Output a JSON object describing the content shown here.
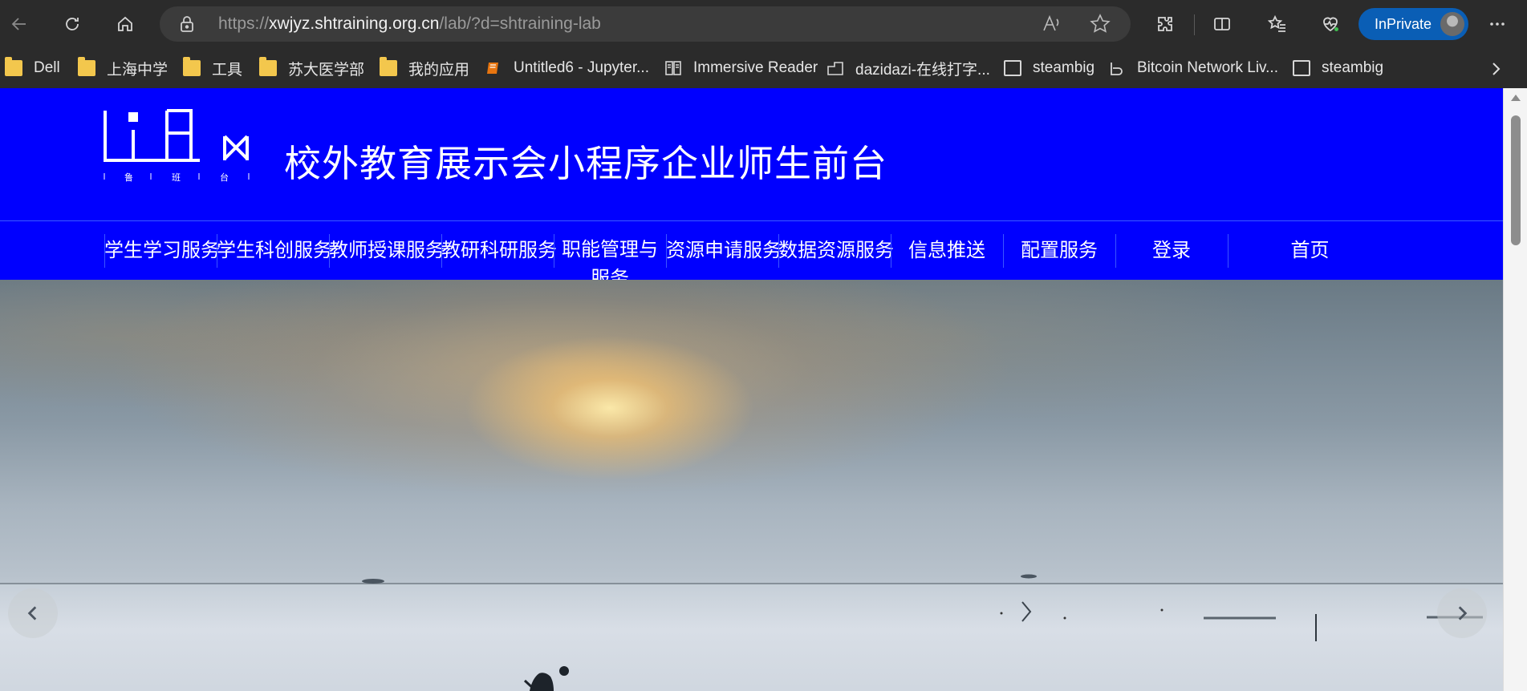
{
  "browser": {
    "url_prefix": "https://",
    "url_host": "xwjyz.shtraining.org.cn",
    "url_path": "/lab/?d=shtraining-lab",
    "inprivate_label": "InPrivate"
  },
  "bookmarks": [
    {
      "label": "Dell",
      "icon": "folder-icon"
    },
    {
      "label": "上海中学",
      "icon": "folder-icon"
    },
    {
      "label": "工具",
      "icon": "folder-icon"
    },
    {
      "label": "苏大医学部",
      "icon": "folder-icon"
    },
    {
      "label": "我的应用",
      "icon": "folder-icon"
    },
    {
      "label": "Untitled6 - Jupyter...",
      "icon": "jupyter-icon"
    },
    {
      "label": "Immersive Reader",
      "icon": "reader-icon"
    },
    {
      "label": "dazidazi-在线打字...",
      "icon": "typing-icon"
    },
    {
      "label": "steambig",
      "icon": "page-icon"
    },
    {
      "label": "Bitcoin Network Liv...",
      "icon": "bitcoin-icon"
    },
    {
      "label": "steambig",
      "icon": "page-icon"
    }
  ],
  "site": {
    "logo_chars": [
      "鲁",
      "班",
      "台"
    ],
    "title": "校外教育展示会小程序企业师生前台",
    "nav": [
      "学生学习服务",
      "学生科创服务",
      "教师授课服务",
      "教研科研服务",
      "职能管理与服务",
      "资源申请服务",
      "数据资源服务",
      "信息推送",
      "配置服务",
      "登录",
      "首页"
    ]
  },
  "colors": {
    "header_blue": "#0000ff",
    "inprivate_blue": "#0a5eb5"
  }
}
